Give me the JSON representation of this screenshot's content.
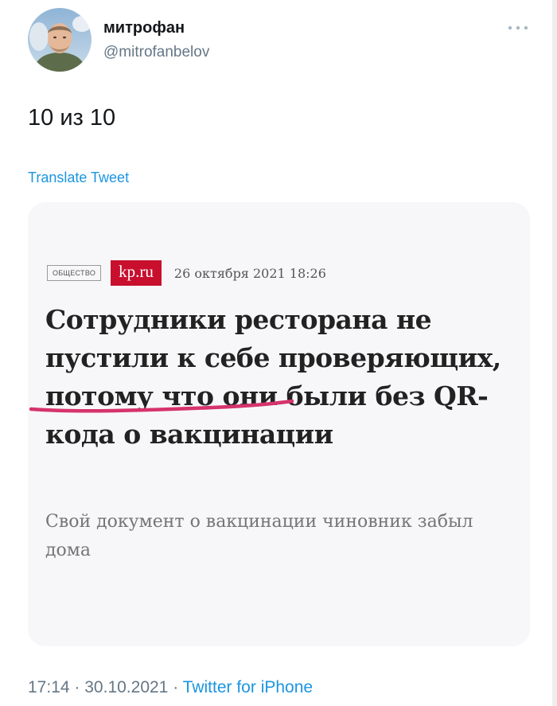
{
  "tweet": {
    "author": {
      "display_name": "митрофан",
      "handle": "@mitrofanbelov"
    },
    "more_icon": "more-dots-icon",
    "text": "10 из 10",
    "translate_label": "Translate Tweet",
    "footer": {
      "time": "17:14",
      "separator": "·",
      "date": "30.10.2021",
      "source": "Twitter for iPhone"
    }
  },
  "article": {
    "section": "ОБЩЕСТВО",
    "logo": "kp.ru",
    "date": "26 октября 2021 18:26",
    "headline": "Сотрудники ресторана не пустили к себе проверяющих, потому что они были без QR-кода о вакцинации",
    "subtitle": "Свой документ о вакцинации чиновник забыл дома"
  },
  "colors": {
    "brand_red": "#c8102e",
    "link_blue": "#1b95e0",
    "underline_mark": "#d6336c"
  }
}
